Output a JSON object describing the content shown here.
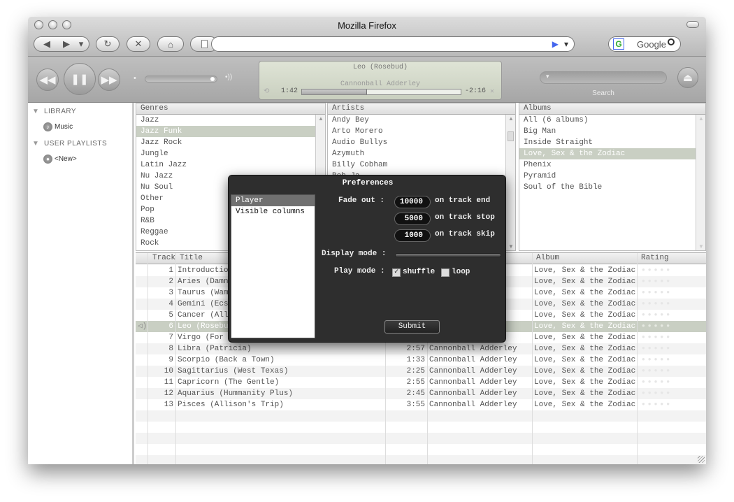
{
  "window": {
    "title": "Mozilla Firefox"
  },
  "toolbar": {
    "back_icon": "◀",
    "forward_icon": "▶",
    "dropdown_icon": "▾",
    "reload_icon": "↻",
    "stop_icon": "✕",
    "home_icon": "⌂",
    "go_icon": "▶",
    "search_engine": "G",
    "search_placeholder": "Google",
    "magnifier": "🔍"
  },
  "player": {
    "track": "Leo (Rosebud)",
    "artist": "Cannonball Adderley",
    "elapsed": "1:42",
    "remaining": "-2:16",
    "progress": 0.41,
    "search_label": "Search",
    "volume_icon": "•))"
  },
  "sidebar": {
    "library_header": "LIBRARY",
    "music": "Music",
    "playlists_header": "USER PLAYLISTS",
    "new_playlist": "<New>"
  },
  "genres": {
    "header": "Genres",
    "items": [
      "Jazz",
      "Jazz Funk",
      "Jazz Rock",
      "Jungle",
      "Latin Jazz",
      "Nu Jazz",
      "Nu Soul",
      "Other",
      "Pop",
      "R&B",
      "Reggae",
      "Rock"
    ],
    "selected": 1
  },
  "artists": {
    "header": "Artists",
    "items": [
      "Andy Bey",
      "Arto Morero",
      "Audio Bullys",
      "Azymuth",
      "Billy Cobham",
      "Bob Ja"
    ]
  },
  "albums": {
    "header": "Albums",
    "items": [
      "All (6 albums)",
      "Big Man",
      "Inside Straight",
      "Love, Sex & the Zodiac",
      "Phenix",
      "Pyramid",
      "Soul of the Bible"
    ],
    "selected": 3
  },
  "tracks": {
    "headers": {
      "track": "Track",
      "title": "Title",
      "album": "Album",
      "rating": "Rating"
    },
    "rows": [
      {
        "n": "1",
        "title": "Introduction",
        "time": "",
        "artist": "",
        "album": "Love, Sex & the Zodiac"
      },
      {
        "n": "2",
        "title": "Aries (Damn",
        "time": "",
        "artist": "",
        "album": "Love, Sex & the Zodiac"
      },
      {
        "n": "3",
        "title": "Taurus (Wamp",
        "time": "",
        "artist": "",
        "album": "Love, Sex & the Zodiac"
      },
      {
        "n": "4",
        "title": "Gemini (Ecst",
        "time": "",
        "artist": "",
        "album": "Love, Sex & the Zodiac"
      },
      {
        "n": "5",
        "title": "Cancer (All",
        "time": "",
        "artist": "",
        "album": "Love, Sex & the Zodiac"
      },
      {
        "n": "6",
        "title": "Leo (Rosebud",
        "time": "",
        "artist": "",
        "album": "Love, Sex & the Zodiac"
      },
      {
        "n": "7",
        "title": "Virgo (For P",
        "time": "",
        "artist": "",
        "album": "Love, Sex & the Zodiac"
      },
      {
        "n": "8",
        "title": "Libra (Patricia)",
        "time": "2:57",
        "artist": "Cannonball Adderley",
        "album": "Love, Sex & the Zodiac"
      },
      {
        "n": "9",
        "title": "Scorpio (Back a Town)",
        "time": "1:33",
        "artist": "Cannonball Adderley",
        "album": "Love, Sex & the Zodiac"
      },
      {
        "n": "10",
        "title": "Sagittarius (West Texas)",
        "time": "2:25",
        "artist": "Cannonball Adderley",
        "album": "Love, Sex & the Zodiac"
      },
      {
        "n": "11",
        "title": "Capricorn (The Gentle)",
        "time": "2:55",
        "artist": "Cannonball Adderley",
        "album": "Love, Sex & the Zodiac"
      },
      {
        "n": "12",
        "title": "Aquarius (Hummanity Plus)",
        "time": "2:45",
        "artist": "Cannonball Adderley",
        "album": "Love, Sex & the Zodiac"
      },
      {
        "n": "13",
        "title": "Pisces (Allison's Trip)",
        "time": "3:55",
        "artist": "Cannonball Adderley",
        "album": "Love, Sex & the Zodiac"
      }
    ],
    "playing": 5,
    "playing_icon": "◁)"
  },
  "preferences": {
    "title": "Preferences",
    "sections": [
      "Player",
      "Visible columns"
    ],
    "fade_out_label": "Fade out :",
    "track_end_value": "10000",
    "track_end_label": "on track end",
    "track_stop_value": "5000",
    "track_stop_label": "on track stop",
    "track_skip_value": "1000",
    "track_skip_label": "on track skip",
    "display_mode_label": "Display mode :",
    "play_mode_label": "Play mode :",
    "shuffle_label": "shuffle",
    "shuffle_mark": "✓",
    "loop_label": "loop",
    "submit_label": "Submit"
  }
}
